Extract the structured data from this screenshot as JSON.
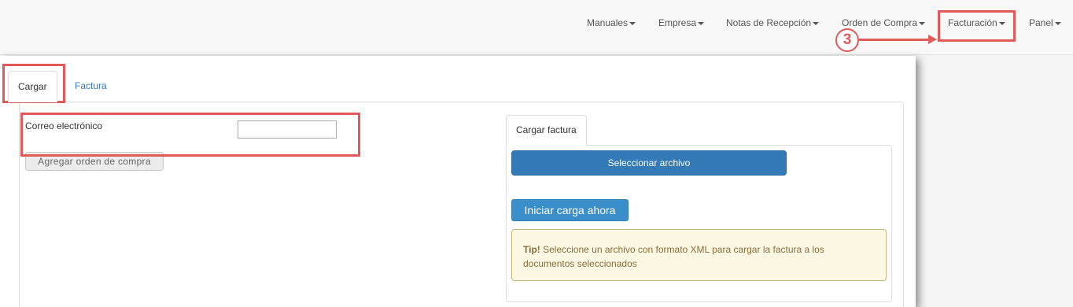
{
  "nav": {
    "items": [
      {
        "label": "Manuales"
      },
      {
        "label": "Empresa"
      },
      {
        "label": "Notas de Recepción"
      },
      {
        "label": "Orden de Compra"
      },
      {
        "label": "Facturación"
      },
      {
        "label": "Panel"
      }
    ]
  },
  "annotation": {
    "step": "3",
    "color": "#e05a5a"
  },
  "tabs": [
    {
      "label": "Cargar"
    },
    {
      "label": "Factura"
    }
  ],
  "form": {
    "email_label": "Correo electrónico",
    "email_value": "",
    "add_order_label": "Agregar orden de compra"
  },
  "upload": {
    "tab_label": "Cargar factura",
    "select_file_label": "Seleccionar archivo",
    "start_upload_label": "Iniciar carga ahora",
    "tip_strong": "Tip!",
    "tip_text": " Seleccione un archivo con formato XML para cargar la factura a los documentos seleccionados"
  },
  "colors": {
    "primary": "#337ab7",
    "callout": "#e05a5a",
    "tip_bg": "#fcf8e3",
    "tip_text": "#8a6d3b"
  }
}
